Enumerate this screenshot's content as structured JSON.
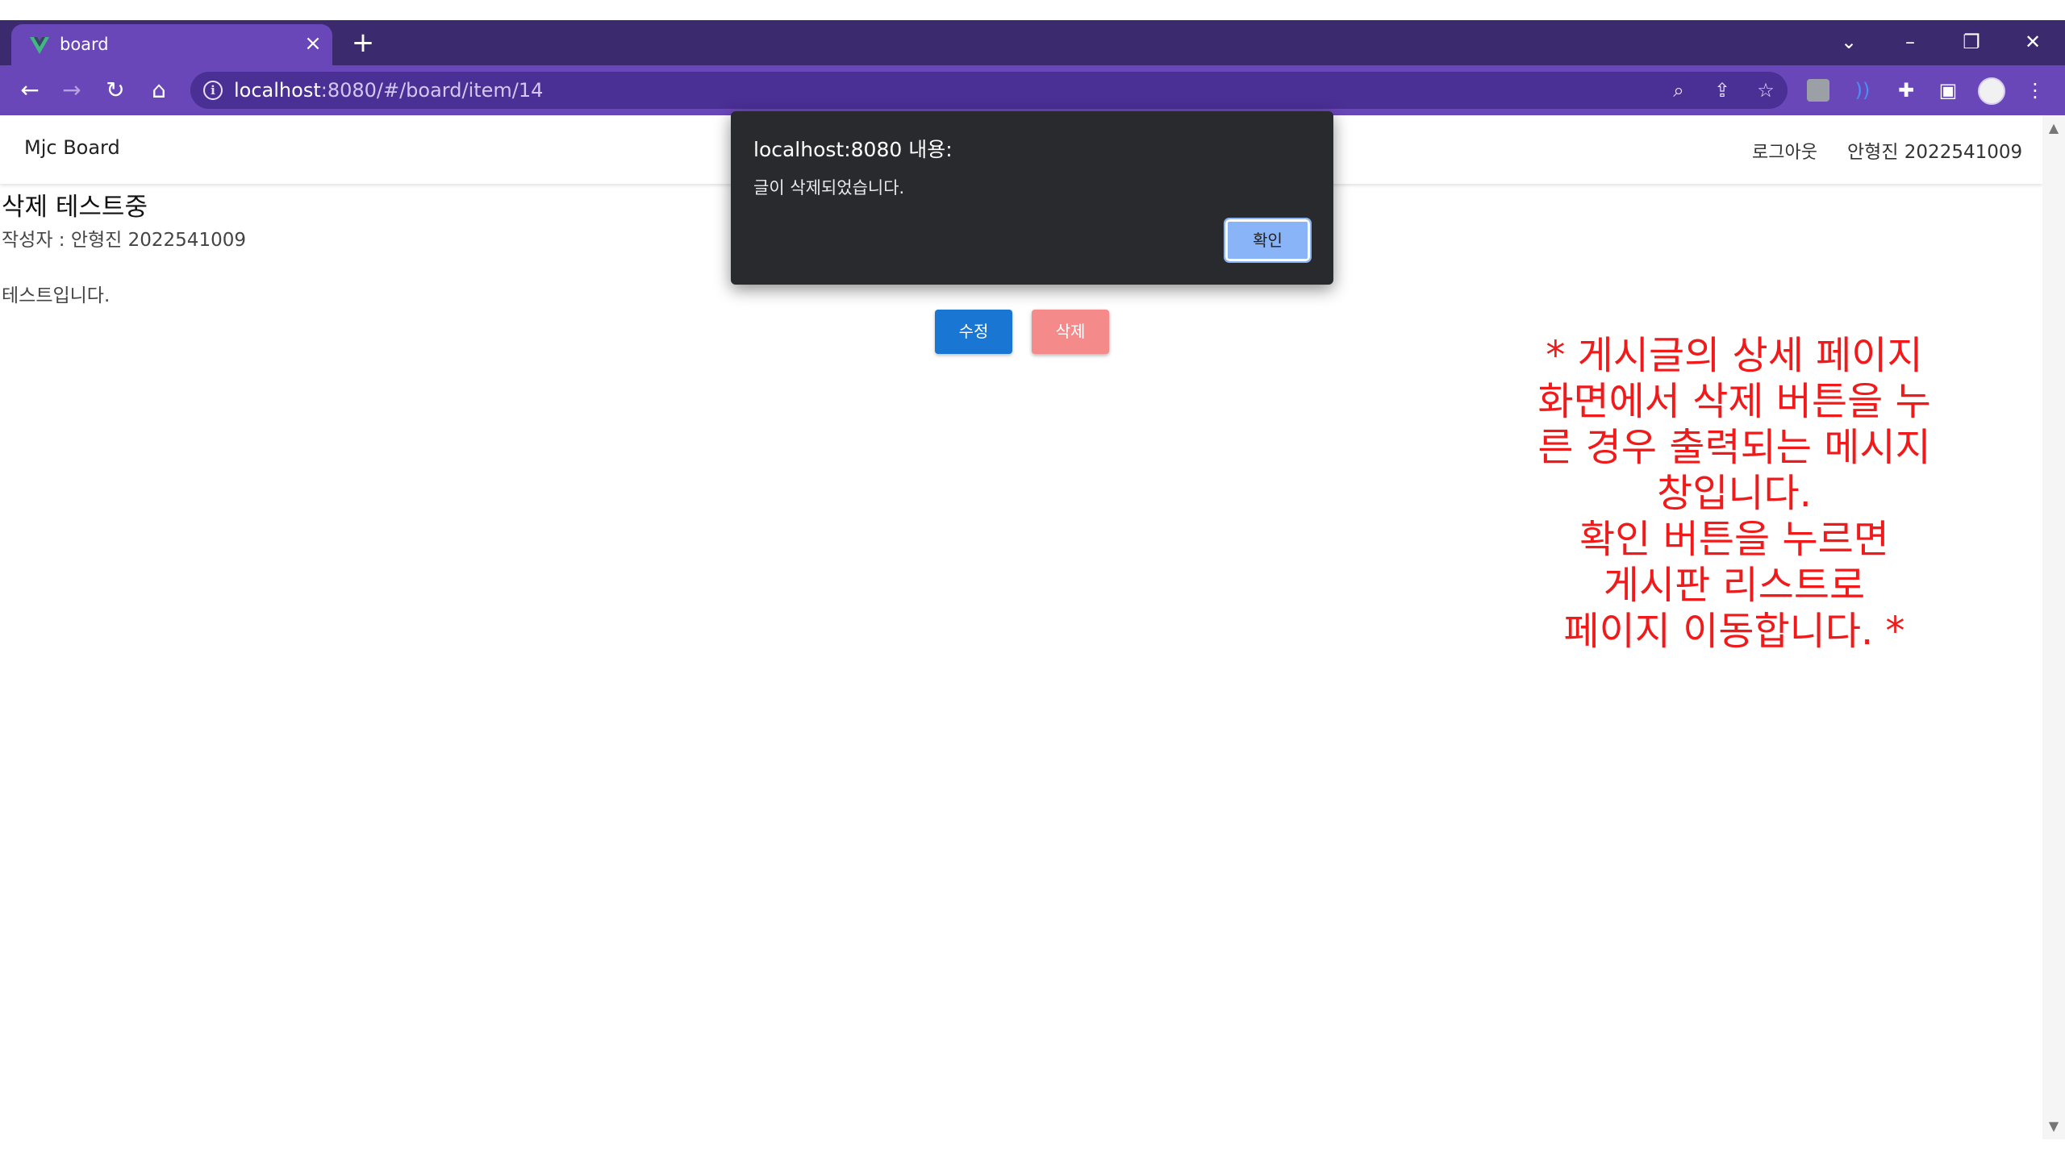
{
  "browser": {
    "tab_title": "board",
    "url_host": "localhost",
    "url_path": ":8080/#/board/item/14"
  },
  "app": {
    "brand": "Mjc Board",
    "logout_label": "로그아웃",
    "user": "안형진 2022541009"
  },
  "post": {
    "title": "삭제 테스트중",
    "author": "작성자 : 안형진 2022541009",
    "body": "테스트입니다.",
    "edit_label": "수정",
    "delete_label": "삭제"
  },
  "dialog": {
    "title": "localhost:8080 내용:",
    "message": "글이 삭제되었습니다.",
    "ok_label": "확인"
  },
  "annotation": {
    "lines": [
      "* 게시글의 상세 페이지",
      "화면에서 삭제 버튼을 누",
      "른 경우 출력되는 메시지",
      "창입니다.",
      "확인 버튼을 누르면",
      "게시판 리스트로",
      "페이지 이동합니다. *"
    ]
  },
  "colors": {
    "browser_frame": "#3b2b6e",
    "browser_toolbar": "#6a47b8",
    "primary_button": "#1976d2",
    "delete_button": "#f48a8a",
    "dialog_bg": "#292a2d",
    "dialog_button": "#8ab4f8",
    "annotation": "#f01a1a"
  }
}
